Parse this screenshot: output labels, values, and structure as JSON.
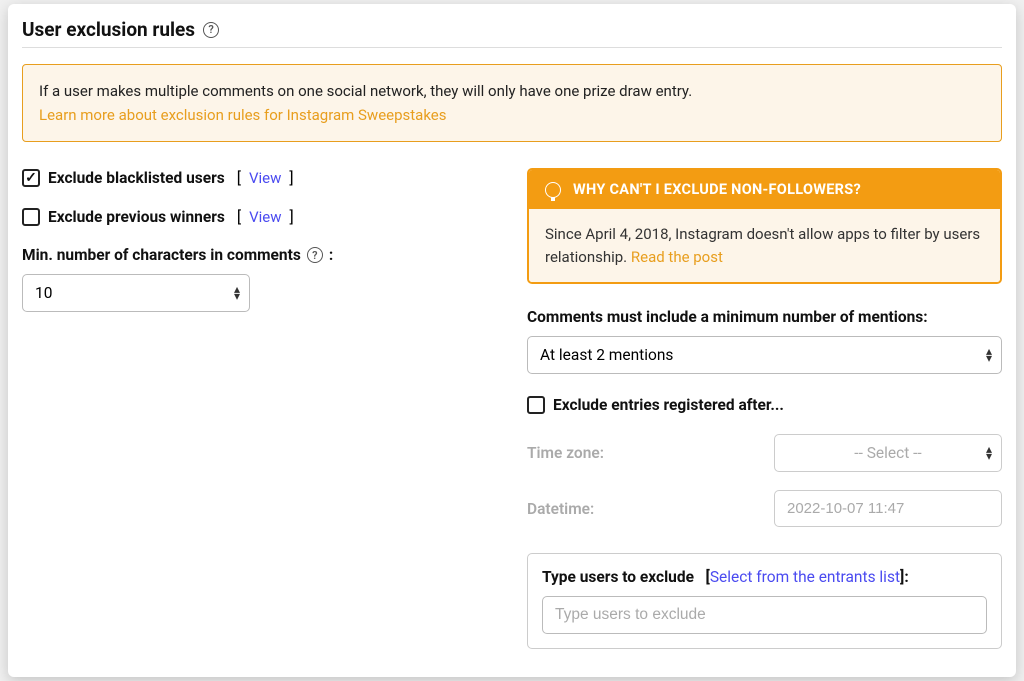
{
  "title": "User exclusion rules",
  "notice": {
    "text": "If a user makes multiple comments on one social network, they will only have one prize draw entry.",
    "link": "Learn more about exclusion rules for Instagram Sweepstakes"
  },
  "left": {
    "blacklist": {
      "label": "Exclude blacklisted users",
      "view": "View",
      "checked": true
    },
    "previous": {
      "label": "Exclude previous winners",
      "view": "View",
      "checked": false
    },
    "minchars": {
      "label": "Min. number of characters in comments",
      "suffix": ":",
      "value": "10"
    }
  },
  "info": {
    "header": "WHY CAN'T I EXCLUDE NON-FOLLOWERS?",
    "body": "Since April 4, 2018, Instagram doesn't allow apps to filter by users relationship.",
    "link": "Read the post"
  },
  "right": {
    "mentions": {
      "label": "Comments must include a minimum number of mentions:",
      "value": "At least 2 mentions"
    },
    "excludeAfter": {
      "label": "Exclude entries registered after...",
      "checked": false
    },
    "timezone": {
      "label": "Time zone:",
      "value": "-- Select --"
    },
    "datetime": {
      "label": "Datetime:",
      "placeholder": "2022-10-07 11:47"
    },
    "typeExclude": {
      "label": "Type users to exclude",
      "selectLink": "Select from the entrants list",
      "suffix": ":",
      "placeholder": "Type users to exclude"
    }
  }
}
